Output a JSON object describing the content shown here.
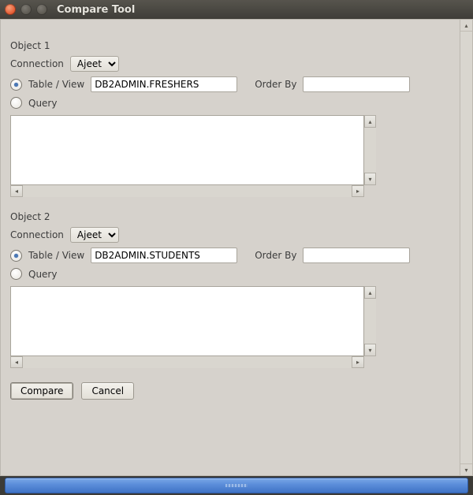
{
  "window": {
    "title": "Compare Tool"
  },
  "object1": {
    "title": "Object 1",
    "connection_label": "Connection",
    "connection_value": "Ajeet",
    "mode_table_label": "Table / View",
    "mode_query_label": "Query",
    "mode_selected": "table",
    "table_value": "DB2ADMIN.FRESHERS",
    "order_by_label": "Order By",
    "order_by_value": "",
    "query_text": ""
  },
  "object2": {
    "title": "Object 2",
    "connection_label": "Connection",
    "connection_value": "Ajeet",
    "mode_table_label": "Table / View",
    "mode_query_label": "Query",
    "mode_selected": "table",
    "table_value": "DB2ADMIN.STUDENTS",
    "order_by_label": "Order By",
    "order_by_value": "",
    "query_text": ""
  },
  "actions": {
    "compare": "Compare",
    "cancel": "Cancel"
  }
}
